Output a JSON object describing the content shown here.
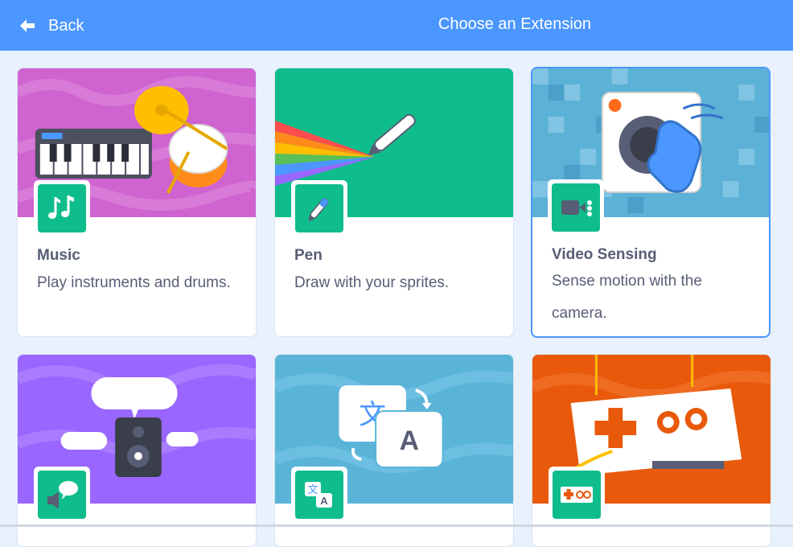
{
  "header": {
    "back_label": "Back",
    "title": "Choose an Extension",
    "color": "#4c97ff"
  },
  "extensions": [
    {
      "name": "Music",
      "description": "Play instruments and drums.",
      "banner_color": "#cf63cf",
      "icon": "music-notes-icon"
    },
    {
      "name": "Pen",
      "description": "Draw with your sprites.",
      "banner_color": "#0fbd8c",
      "icon": "pen-icon"
    },
    {
      "name": "Video Sensing",
      "description": "Sense motion with the camera.",
      "banner_color": "#5cb1d6",
      "icon": "video-camera-icon",
      "selected": true
    },
    {
      "name": "",
      "description": "",
      "banner_color": "#9966ff",
      "icon": "speaker-speech-icon"
    },
    {
      "name": "",
      "description": "",
      "banner_color": "#5ab4d8",
      "icon": "translate-icon"
    },
    {
      "name": "",
      "description": "",
      "banner_color": "#e8590c",
      "icon": "game-controller-icon"
    }
  ],
  "colors": {
    "accent": "#4c97ff",
    "icon_tile": "#0fbd8c",
    "text": "#575e75",
    "background": "#e9f1fc"
  }
}
